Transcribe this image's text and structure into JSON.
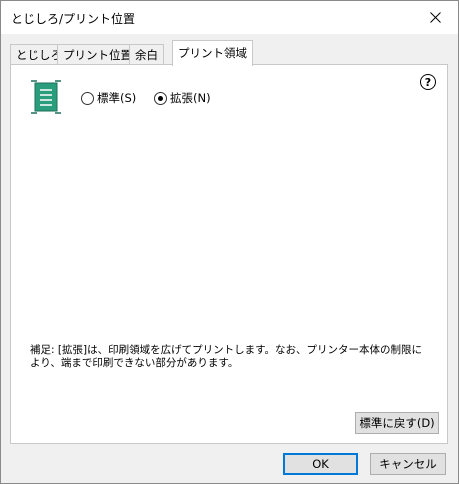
{
  "window": {
    "title": "とじしろ/プリント位置",
    "close_glyph": "✕"
  },
  "tabs": [
    {
      "label": "とじしろ"
    },
    {
      "label": "プリント位置"
    },
    {
      "label": "余白"
    },
    {
      "label": "プリント領域"
    }
  ],
  "active_tab": "プリント領域",
  "panel": {
    "help_glyph": "?",
    "options": [
      {
        "label": "標準(S)",
        "checked": false
      },
      {
        "label": "拡張(N)",
        "checked": true
      }
    ],
    "note": "補足: [拡張]は、印刷領域を広げてプリントします。なお、プリンター本体の制限により、端まで印刷できない部分があります。",
    "restore_label": "標準に戻す(D)"
  },
  "footer": {
    "ok_label": "OK",
    "cancel_label": "キャンセル"
  },
  "colors": {
    "paper_icon": "#2a9d7d",
    "default_button_border": "#0078d7"
  }
}
